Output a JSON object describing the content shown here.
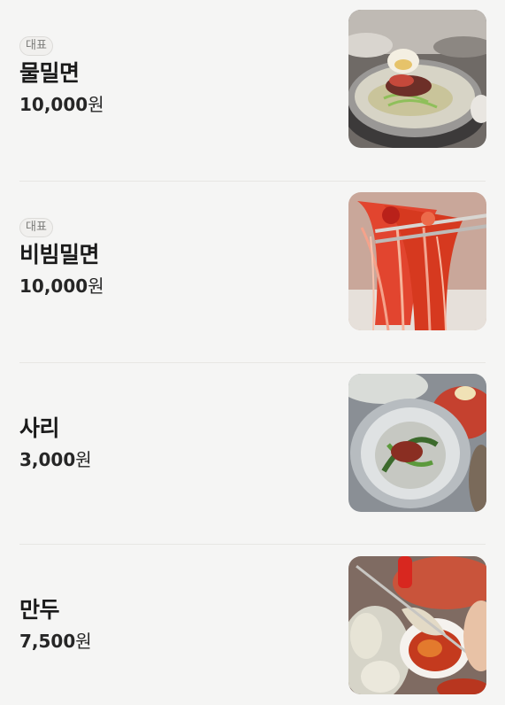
{
  "menu": {
    "items": [
      {
        "badge": "대표",
        "name": "물밀면",
        "price": "10,000",
        "unit": "원",
        "photo_icon": "mul-milmyeon-photo"
      },
      {
        "badge": "대표",
        "name": "비빔밀면",
        "price": "10,000",
        "unit": "원",
        "photo_icon": "bibim-milmyeon-photo"
      },
      {
        "name": "사리",
        "price": "3,000",
        "unit": "원",
        "photo_icon": "sari-photo"
      },
      {
        "name": "만두",
        "price": "7,500",
        "unit": "원",
        "photo_icon": "mandu-photo"
      }
    ]
  }
}
